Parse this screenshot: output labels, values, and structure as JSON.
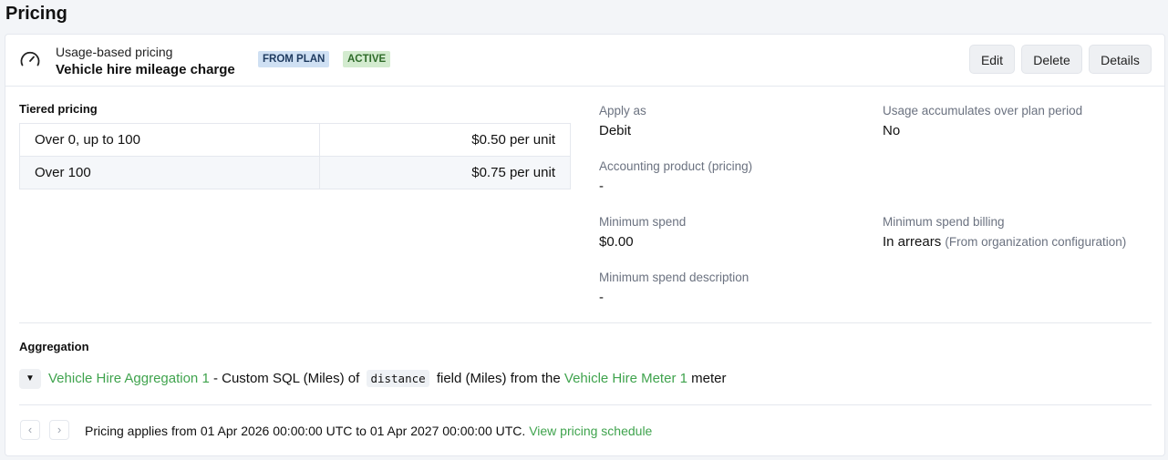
{
  "page": {
    "title": "Pricing"
  },
  "charge": {
    "type_label": "Usage-based pricing",
    "name": "Vehicle hire mileage charge",
    "badges": {
      "from_plan": "FROM PLAN",
      "active": "ACTIVE"
    },
    "actions": {
      "edit": "Edit",
      "delete": "Delete",
      "details": "Details"
    }
  },
  "tiers": {
    "heading": "Tiered pricing",
    "rows": [
      {
        "range": "Over 0, up to 100",
        "price": "$0.50 per unit"
      },
      {
        "range": "Over 100",
        "price": "$0.75 per unit"
      }
    ]
  },
  "fields": {
    "apply_as": {
      "label": "Apply as",
      "value": "Debit"
    },
    "usage_accumulates": {
      "label": "Usage accumulates over plan period",
      "value": "No"
    },
    "accounting_product": {
      "label": "Accounting product (pricing)",
      "value": "-"
    },
    "minimum_spend": {
      "label": "Minimum spend",
      "value": "$0.00"
    },
    "minimum_spend_billing": {
      "label": "Minimum spend billing",
      "value": "In arrears",
      "note": "(From organization configuration)"
    },
    "minimum_spend_description": {
      "label": "Minimum spend description",
      "value": "-"
    }
  },
  "aggregation": {
    "heading": "Aggregation",
    "aggregation_link": "Vehicle Hire Aggregation 1",
    "text_1": " - Custom SQL (Miles) of",
    "field_code": "distance",
    "text_2": "field (Miles) from the ",
    "meter_link": "Vehicle Hire Meter 1",
    "text_3": " meter"
  },
  "schedule": {
    "text": "Pricing applies from 01 Apr 2026 00:00:00 UTC to 01 Apr 2027 00:00:00 UTC. ",
    "link": "View pricing schedule",
    "prev_icon": "‹",
    "next_icon": "›"
  },
  "colors": {
    "accent_green": "#3fa34d",
    "badge_blue": "#cfe0f3",
    "badge_green": "#d3ebcf"
  }
}
